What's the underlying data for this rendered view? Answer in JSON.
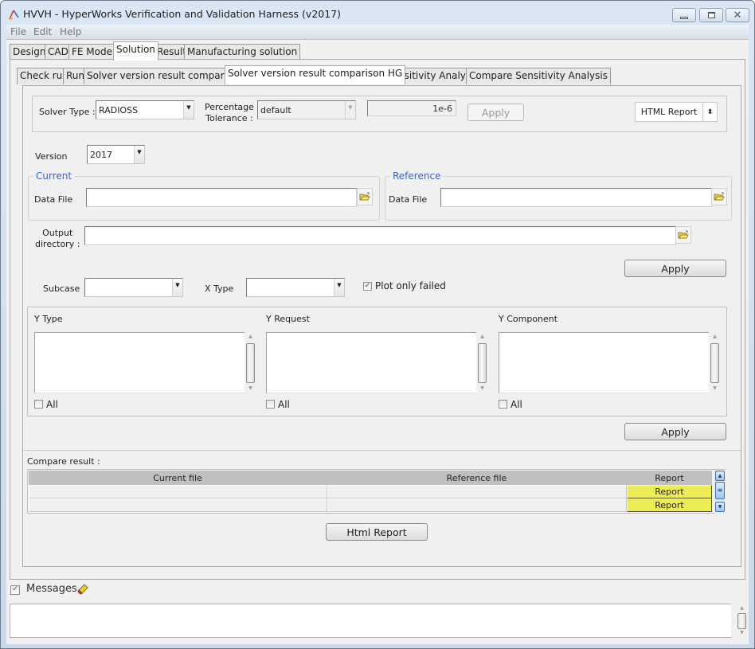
{
  "window": {
    "title": "HVVH - HyperWorks Verification and Validation Harness (v2017)",
    "controls": {
      "minimize": "minimize",
      "maximize": "maximize",
      "close": "close"
    }
  },
  "menu": [
    "File",
    "Edit",
    "Help"
  ],
  "main_tabs": [
    {
      "label": "Design",
      "active": false
    },
    {
      "label": "CAD",
      "active": false
    },
    {
      "label": "FE Model",
      "active": false
    },
    {
      "label": "Solution",
      "active": true
    },
    {
      "label": "Result",
      "active": false
    },
    {
      "label": "Manufacturing solution",
      "active": false
    }
  ],
  "sub_tabs": [
    {
      "label": "Check run",
      "active": false
    },
    {
      "label": "Run",
      "active": false
    },
    {
      "label": "Solver version result comparison",
      "active": false
    },
    {
      "label": "Solver version result comparison HG",
      "active": true
    },
    {
      "label": "Sensitivity Analysis",
      "active": false
    },
    {
      "label": "Compare Sensitivity Analysis",
      "active": false
    }
  ],
  "settings": {
    "solver_type_label": "Solver Type :",
    "solver_type_value": "RADIOSS",
    "tolerance_label_1": "Percentage",
    "tolerance_label_2": "Tolerance :",
    "tolerance_value": "default",
    "tolerance_input": "1e-6",
    "apply_label": "Apply",
    "report_type": "HTML Report"
  },
  "version": {
    "label": "Version",
    "value": "2017"
  },
  "current": {
    "title": "Current",
    "data_file_label": "Data File",
    "data_file_value": ""
  },
  "reference": {
    "title": "Reference",
    "data_file_label": "Data File",
    "data_file_value": ""
  },
  "output": {
    "label_1": "Output",
    "label_2": "directory :",
    "value": ""
  },
  "apply_1_label": "Apply",
  "filters": {
    "subcase_label": "Subcase",
    "subcase_value": "",
    "xtype_label": "X Type",
    "xtype_value": "",
    "plot_only_failed_label": "Plot only failed",
    "plot_only_failed_checked": true
  },
  "lists": [
    {
      "title": "Y Type",
      "all_label": "All",
      "all_checked": false
    },
    {
      "title": "Y Request",
      "all_label": "All",
      "all_checked": false
    },
    {
      "title": "Y Component",
      "all_label": "All",
      "all_checked": false
    }
  ],
  "apply_2_label": "Apply",
  "compare": {
    "label": "Compare result :",
    "columns": [
      "Current file",
      "Reference file",
      "Report"
    ],
    "rows": [
      {
        "current": "",
        "reference": "",
        "report": "Report"
      },
      {
        "current": "",
        "reference": "",
        "report": "Report"
      }
    ],
    "report_color": "#ecec55"
  },
  "html_report_label": "Html Report",
  "messages": {
    "label": "Messages",
    "checked": true,
    "content": ""
  }
}
